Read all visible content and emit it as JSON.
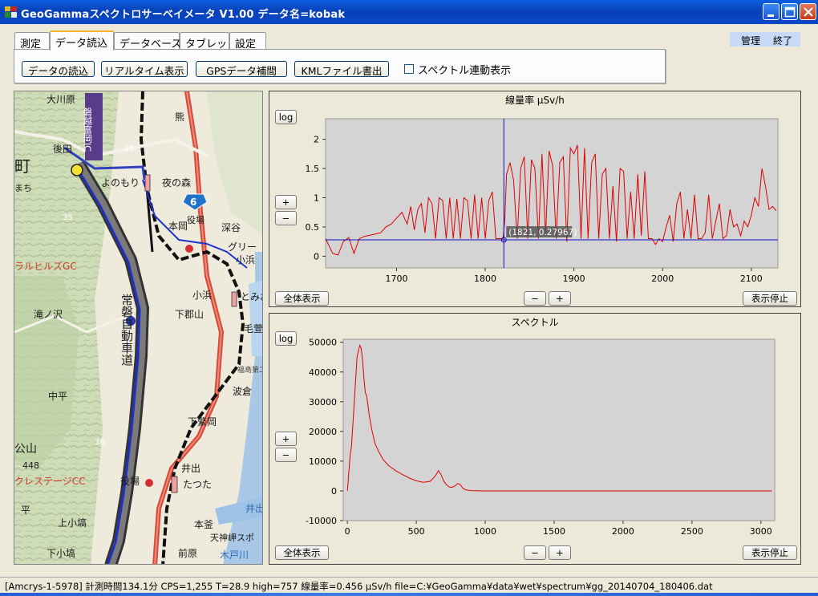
{
  "window": {
    "title": "GeoGammaスペクトロサーベイメータ V1.00 データ名=kobak",
    "icon": "app-icon",
    "controls": [
      "minimize-icon",
      "maximize-icon",
      "close-icon"
    ]
  },
  "tabs": [
    {
      "label": "測定",
      "active": false
    },
    {
      "label": "データ読込",
      "active": true
    },
    {
      "label": "データベース",
      "active": false
    },
    {
      "label": "タブレット",
      "active": false
    },
    {
      "label": "設定",
      "active": false
    }
  ],
  "admin": {
    "manage_label": "管理",
    "exit_label": "終了"
  },
  "toolbar": {
    "load_label": "データの読込",
    "realtime_label": "リアルタイム表示",
    "gps_label": "GPSデータ補間",
    "kml_label": "KMLファイル書出",
    "spectrum_link_label": "スペクトル連動表示",
    "spectrum_link_checked": false
  },
  "map": {
    "labels": [
      "大川原",
      "磐越富岡IC",
      "熊",
      "後田",
      "町",
      "まち",
      "よのもり",
      "夜の森",
      "6",
      "深谷",
      "本岡",
      "役場",
      "グリー",
      "小浜",
      "ラルヒルズGC",
      "小浜",
      "とみお",
      "常磐自動車道",
      "滝ノ沢",
      "下郡山",
      "毛萱",
      "福島第二原子力",
      "波倉",
      "中平",
      "下繁岡",
      "36",
      "公山",
      "448",
      "井出",
      "たつた",
      "役場",
      "クレステージCC",
      "平",
      "上小塙",
      "井出川",
      "本釜",
      "天神岬スポ",
      "下小塙",
      "前原",
      "木戸川",
      "36",
      "35"
    ]
  },
  "dose_panel": {
    "title": "線量率 μSv/h",
    "log_label": "log",
    "plus_label": "+",
    "minus_label": "−",
    "fit_label": "全体表示",
    "stop_label": "表示停止",
    "cursor_readout": "(1821, 0.27967)"
  },
  "spectrum_panel": {
    "title": "スペクトル",
    "log_label": "log",
    "plus_label": "+",
    "minus_label": "−",
    "fit_label": "全体表示",
    "stop_label": "表示停止"
  },
  "status": {
    "text": "[Amcrys-1-5978] 計測時間134.1分  CPS=1,255  T=28.9  high=757 線量率=0.456 μSv/h  file=C:¥GeoGamma¥data¥wet¥spectrum¥gg_20140704_180406.dat"
  },
  "colors": {
    "plot_bg": "#d4d4d4",
    "series": "#e00000",
    "cursor": "#1010c0",
    "titlebar": "#0a4fd8"
  },
  "chart_data": [
    {
      "type": "line",
      "title": "線量率 μSv/h",
      "xlim": [
        1620,
        2130
      ],
      "ylim": [
        -0.2,
        2.35
      ],
      "xticks": [
        1700,
        1800,
        1900,
        2000,
        2100
      ],
      "yticks": [
        0,
        0.5,
        1,
        1.5,
        2
      ],
      "ytick_labels": [
        "0",
        "0.5",
        "1",
        "1.5",
        "2"
      ],
      "grid": false,
      "cursor": {
        "x": 1821,
        "y": 0.27967
      },
      "series": [
        {
          "x": [
            1620,
            1628,
            1634,
            1640,
            1646,
            1652,
            1658,
            1664,
            1670,
            1676,
            1682,
            1688,
            1694,
            1700,
            1706,
            1712,
            1716,
            1720,
            1724,
            1728,
            1732,
            1736,
            1740,
            1744,
            1748,
            1752,
            1756,
            1760,
            1764,
            1768,
            1772,
            1776,
            1780,
            1784,
            1788,
            1792,
            1796,
            1800,
            1804,
            1808,
            1812,
            1816,
            1820,
            1822,
            1824,
            1828,
            1832,
            1836,
            1840,
            1844,
            1848,
            1852,
            1856,
            1860,
            1864,
            1868,
            1872,
            1876,
            1880,
            1884,
            1888,
            1892,
            1896,
            1900,
            1904,
            1908,
            1912,
            1916,
            1920,
            1924,
            1928,
            1932,
            1936,
            1940,
            1944,
            1948,
            1952,
            1956,
            1960,
            1964,
            1968,
            1972,
            1976,
            1980,
            1984,
            1988,
            1992,
            1996,
            2000,
            2004,
            2008,
            2012,
            2016,
            2020,
            2024,
            2028,
            2032,
            2036,
            2040,
            2044,
            2048,
            2052,
            2056,
            2060,
            2064,
            2068,
            2072,
            2076,
            2080,
            2084,
            2088,
            2092,
            2096,
            2100,
            2104,
            2108,
            2112,
            2116,
            2120,
            2124,
            2128
          ],
          "y": [
            0.3,
            0.05,
            0.02,
            0.25,
            0.32,
            0.05,
            0.3,
            0.34,
            0.36,
            0.38,
            0.4,
            0.5,
            0.55,
            0.65,
            0.75,
            0.55,
            0.85,
            0.45,
            0.8,
            0.9,
            0.4,
            1.0,
            0.9,
            0.3,
            1.0,
            0.95,
            0.3,
            1.0,
            0.3,
            0.98,
            0.3,
            1.0,
            0.95,
            0.3,
            1.05,
            0.3,
            1.0,
            0.3,
            0.95,
            1.1,
            0.3,
            0.3,
            0.3,
            0.6,
            1.4,
            1.6,
            1.3,
            0.3,
            1.5,
            1.7,
            0.3,
            1.65,
            1.5,
            0.3,
            1.75,
            0.35,
            1.8,
            1.55,
            0.3,
            1.6,
            1.7,
            0.25,
            1.85,
            1.75,
            1.9,
            0.3,
            1.85,
            0.3,
            1.6,
            1.75,
            0.3,
            1.4,
            1.5,
            0.3,
            1.2,
            0.25,
            1.5,
            1.45,
            0.3,
            1.1,
            0.3,
            1.4,
            0.35,
            1.45,
            0.3,
            0.3,
            0.2,
            0.3,
            0.25,
            0.5,
            0.7,
            0.25,
            0.9,
            1.1,
            0.3,
            0.8,
            0.3,
            1.05,
            0.3,
            0.3,
            0.4,
            1.05,
            0.3,
            0.6,
            0.9,
            0.3,
            0.35,
            0.8,
            0.5,
            0.55,
            0.35,
            0.6,
            0.5,
            0.7,
            1.0,
            0.85,
            1.5,
            1.2,
            0.8,
            0.85,
            0.78
          ]
        }
      ]
    },
    {
      "type": "line",
      "title": "スペクトル",
      "xlim": [
        -30,
        3100
      ],
      "ylim": [
        -10000,
        51000
      ],
      "xticks": [
        0,
        500,
        1000,
        1500,
        2000,
        2500,
        3000
      ],
      "yticks": [
        -10000,
        0,
        10000,
        20000,
        30000,
        40000,
        50000
      ],
      "grid": false,
      "series": [
        {
          "x": [
            0,
            20,
            30,
            50,
            70,
            90,
            100,
            110,
            120,
            130,
            140,
            160,
            180,
            200,
            230,
            260,
            300,
            350,
            400,
            450,
            500,
            550,
            600,
            620,
            640,
            660,
            680,
            700,
            720,
            740,
            760,
            780,
            800,
            820,
            840,
            860,
            900,
            1000,
            1200,
            1500,
            2000,
            2500,
            3000,
            3080
          ],
          "y": [
            0,
            12000,
            15000,
            30000,
            45000,
            49000,
            48000,
            44000,
            38000,
            33000,
            32000,
            25000,
            20000,
            16000,
            13000,
            10500,
            8500,
            6800,
            5500,
            4300,
            3400,
            2900,
            3200,
            4100,
            5200,
            6800,
            5500,
            3200,
            2000,
            1300,
            1200,
            1600,
            2500,
            2000,
            800,
            300,
            100,
            0,
            0,
            0,
            0,
            0,
            0,
            0
          ]
        }
      ]
    }
  ]
}
